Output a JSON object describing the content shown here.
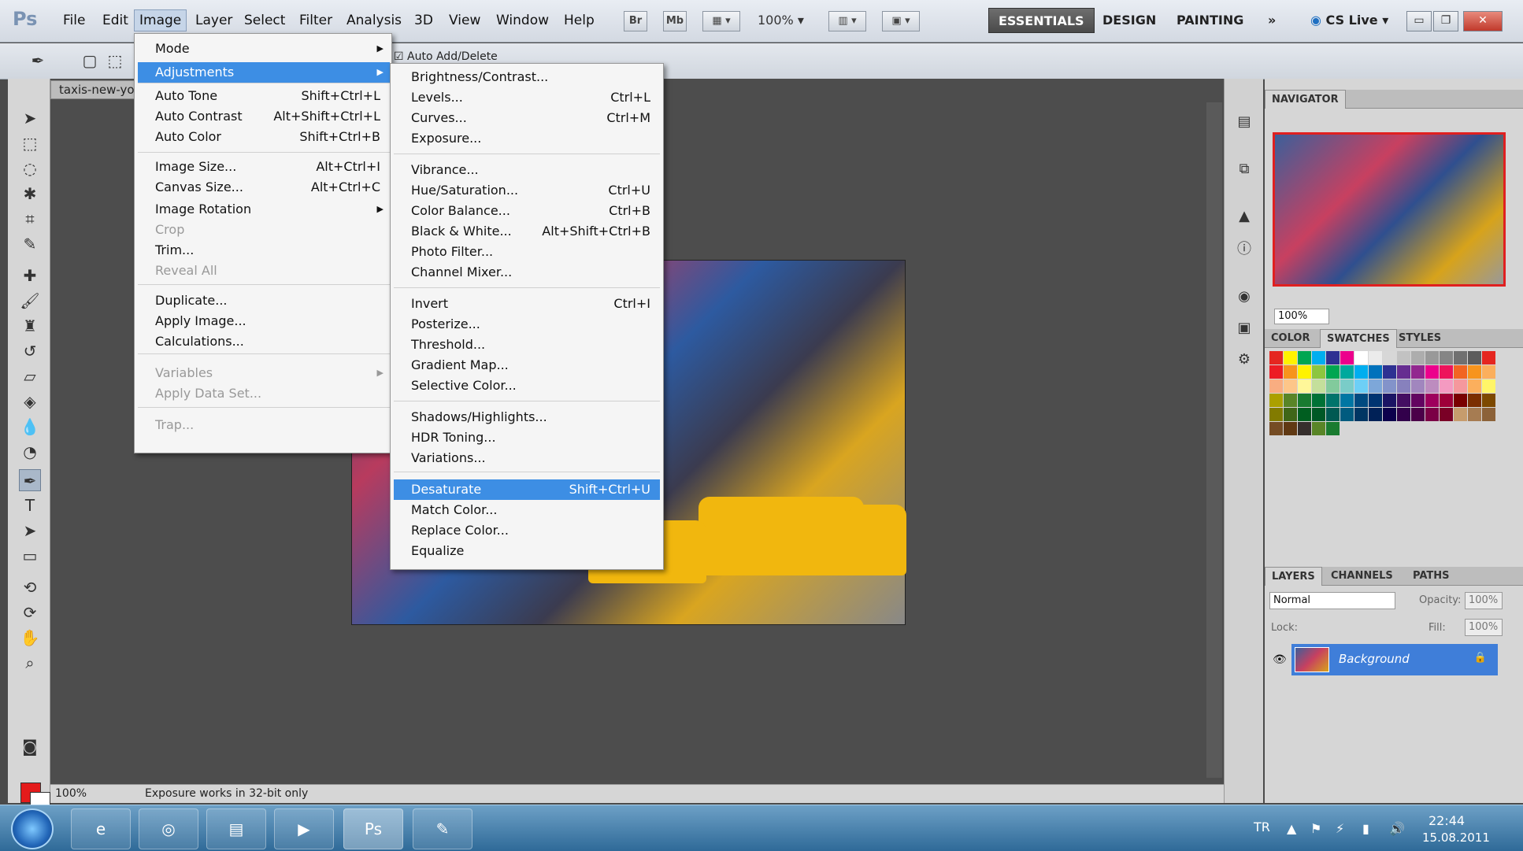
{
  "menubar": {
    "logo": "Ps",
    "items": [
      "File",
      "Edit",
      "Image",
      "Layer",
      "Select",
      "Filter",
      "Analysis",
      "3D",
      "View",
      "Window",
      "Help"
    ],
    "bridge_label": "Br",
    "minibridge_label": "Mb",
    "zoom": "100%",
    "workspaces": [
      "ESSENTIALS",
      "DESIGN",
      "PAINTING"
    ],
    "more_label": "»",
    "cslive": "CS Live"
  },
  "options": {
    "auto_add_delete": "Auto Add/Delete"
  },
  "document": {
    "tab_title": "taxis-new-yo",
    "status_zoom": "100%",
    "status_text": "Exposure works in 32-bit only"
  },
  "image_menu": {
    "items": [
      {
        "label": "Mode",
        "shortcut": "",
        "submenu": true,
        "disabled": false
      },
      {
        "label": "Adjustments",
        "shortcut": "",
        "submenu": true,
        "disabled": false,
        "highlight": true
      },
      {
        "label": "Auto Tone",
        "shortcut": "Shift+Ctrl+L"
      },
      {
        "label": "Auto Contrast",
        "shortcut": "Alt+Shift+Ctrl+L"
      },
      {
        "label": "Auto Color",
        "shortcut": "Shift+Ctrl+B"
      },
      {
        "label": "Image Size...",
        "shortcut": "Alt+Ctrl+I"
      },
      {
        "label": "Canvas Size...",
        "shortcut": "Alt+Ctrl+C"
      },
      {
        "label": "Image Rotation",
        "shortcut": "",
        "submenu": true
      },
      {
        "label": "Crop",
        "shortcut": "",
        "disabled": true
      },
      {
        "label": "Trim...",
        "shortcut": ""
      },
      {
        "label": "Reveal All",
        "shortcut": "",
        "disabled": true
      },
      {
        "label": "Duplicate...",
        "shortcut": ""
      },
      {
        "label": "Apply Image...",
        "shortcut": ""
      },
      {
        "label": "Calculations...",
        "shortcut": ""
      },
      {
        "label": "Variables",
        "shortcut": "",
        "submenu": true,
        "disabled": true
      },
      {
        "label": "Apply Data Set...",
        "shortcut": "",
        "disabled": true
      },
      {
        "label": "Trap...",
        "shortcut": "",
        "disabled": true
      }
    ]
  },
  "adjustments_menu": {
    "items": [
      {
        "label": "Brightness/Contrast...",
        "shortcut": ""
      },
      {
        "label": "Levels...",
        "shortcut": "Ctrl+L"
      },
      {
        "label": "Curves...",
        "shortcut": "Ctrl+M"
      },
      {
        "label": "Exposure...",
        "shortcut": ""
      },
      {
        "label": "Vibrance...",
        "shortcut": ""
      },
      {
        "label": "Hue/Saturation...",
        "shortcut": "Ctrl+U"
      },
      {
        "label": "Color Balance...",
        "shortcut": "Ctrl+B"
      },
      {
        "label": "Black & White...",
        "shortcut": "Alt+Shift+Ctrl+B"
      },
      {
        "label": "Photo Filter...",
        "shortcut": ""
      },
      {
        "label": "Channel Mixer...",
        "shortcut": ""
      },
      {
        "label": "Invert",
        "shortcut": "Ctrl+I"
      },
      {
        "label": "Posterize...",
        "shortcut": ""
      },
      {
        "label": "Threshold...",
        "shortcut": ""
      },
      {
        "label": "Gradient Map...",
        "shortcut": ""
      },
      {
        "label": "Selective Color...",
        "shortcut": ""
      },
      {
        "label": "Shadows/Highlights...",
        "shortcut": ""
      },
      {
        "label": "HDR Toning...",
        "shortcut": ""
      },
      {
        "label": "Variations...",
        "shortcut": ""
      },
      {
        "label": "Desaturate",
        "shortcut": "Shift+Ctrl+U",
        "highlight": true
      },
      {
        "label": "Match Color...",
        "shortcut": ""
      },
      {
        "label": "Replace Color...",
        "shortcut": ""
      },
      {
        "label": "Equalize",
        "shortcut": ""
      }
    ]
  },
  "panels": {
    "navigator_tab": "NAVIGATOR",
    "navigator_zoom": "100%",
    "color_tabs": [
      "COLOR",
      "SWATCHES",
      "STYLES"
    ],
    "layer_tabs": [
      "LAYERS",
      "CHANNELS",
      "PATHS"
    ],
    "blend_mode": "Normal",
    "opacity_label": "Opacity:",
    "opacity_value": "100%",
    "lock_label": "Lock:",
    "fill_label": "Fill:",
    "fill_value": "100%",
    "layer_name": "Background"
  },
  "colors": {
    "foreground": "#e41b1b",
    "background": "#ffffff",
    "highlight": "#3d8ee4"
  },
  "taskbar": {
    "lang": "TR",
    "time": "22:44",
    "date": "15.08.2011",
    "apps": [
      "internet-explorer",
      "chrome",
      "file-explorer",
      "media-player",
      "photoshop",
      "paint"
    ],
    "photoshop_label": "Ps"
  }
}
